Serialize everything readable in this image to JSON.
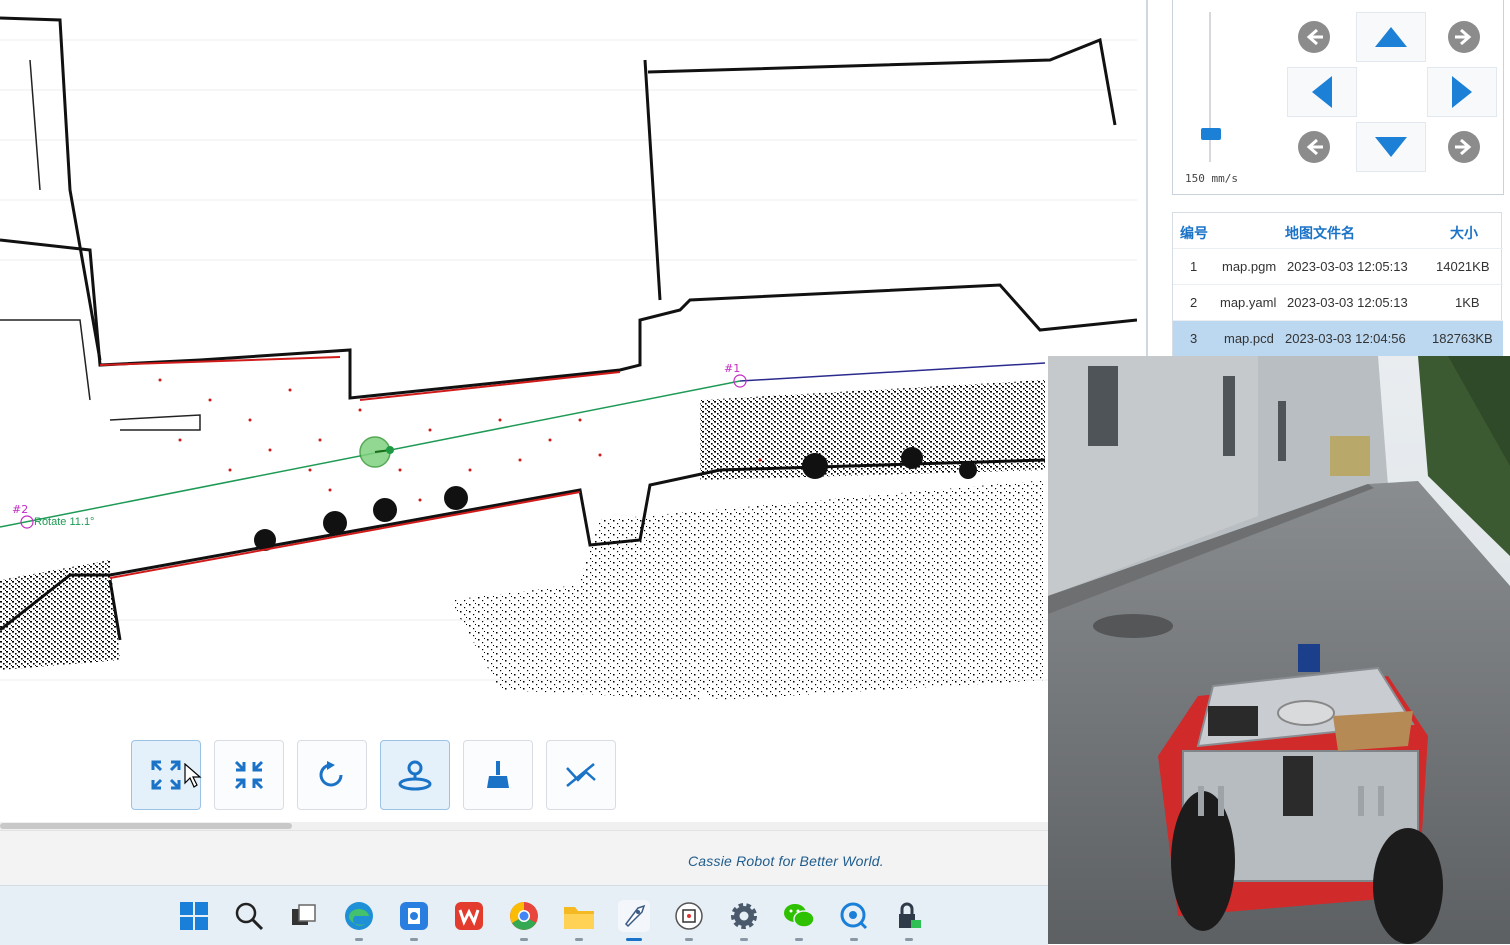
{
  "map": {
    "waypoint_1_label": "#1",
    "waypoint_2_label": "#2",
    "rotate_label": "Rotate 11.1°"
  },
  "toolbar": {
    "buttons": [
      {
        "name": "zoom-fit-button",
        "icon": "expand-icon",
        "active": true
      },
      {
        "name": "zoom-shrink-button",
        "icon": "compress-icon",
        "active": false
      },
      {
        "name": "reset-view-button",
        "icon": "rotate-icon",
        "active": false
      },
      {
        "name": "set-pose-button",
        "icon": "robot-pose-icon",
        "active": true
      },
      {
        "name": "clear-button",
        "icon": "broom-icon",
        "active": false
      },
      {
        "name": "path-tool-button",
        "icon": "path-icon",
        "active": false
      }
    ]
  },
  "status": {
    "slogan": "Cassie Robot for Better World."
  },
  "control": {
    "speed_label": "150 mm/s",
    "speed_level": 0.15,
    "accent": "#1b80d6"
  },
  "files": {
    "headers": {
      "index": "编号",
      "name": "地图文件名",
      "size": "大小"
    },
    "rows": [
      {
        "index": "1",
        "name": "map.pgm",
        "date": "2023-03-03 12:05:13",
        "size": "14021KB",
        "selected": false
      },
      {
        "index": "2",
        "name": "map.yaml",
        "date": "2023-03-03 12:05:13",
        "size": "1KB",
        "selected": false
      },
      {
        "index": "3",
        "name": "map.pcd",
        "date": "2023-03-03 12:04:56",
        "size": "182763KB",
        "selected": true
      }
    ]
  },
  "taskbar": {
    "icons": [
      "windows-start-icon",
      "search-icon",
      "task-view-icon",
      "edge-browser-icon",
      "app-store-icon",
      "wps-office-icon",
      "chrome-icon",
      "file-explorer-icon",
      "rocket-app-icon",
      "robot-app-icon",
      "settings-gear-icon",
      "wechat-icon",
      "chat-bubble-icon",
      "security-lock-icon"
    ]
  }
}
